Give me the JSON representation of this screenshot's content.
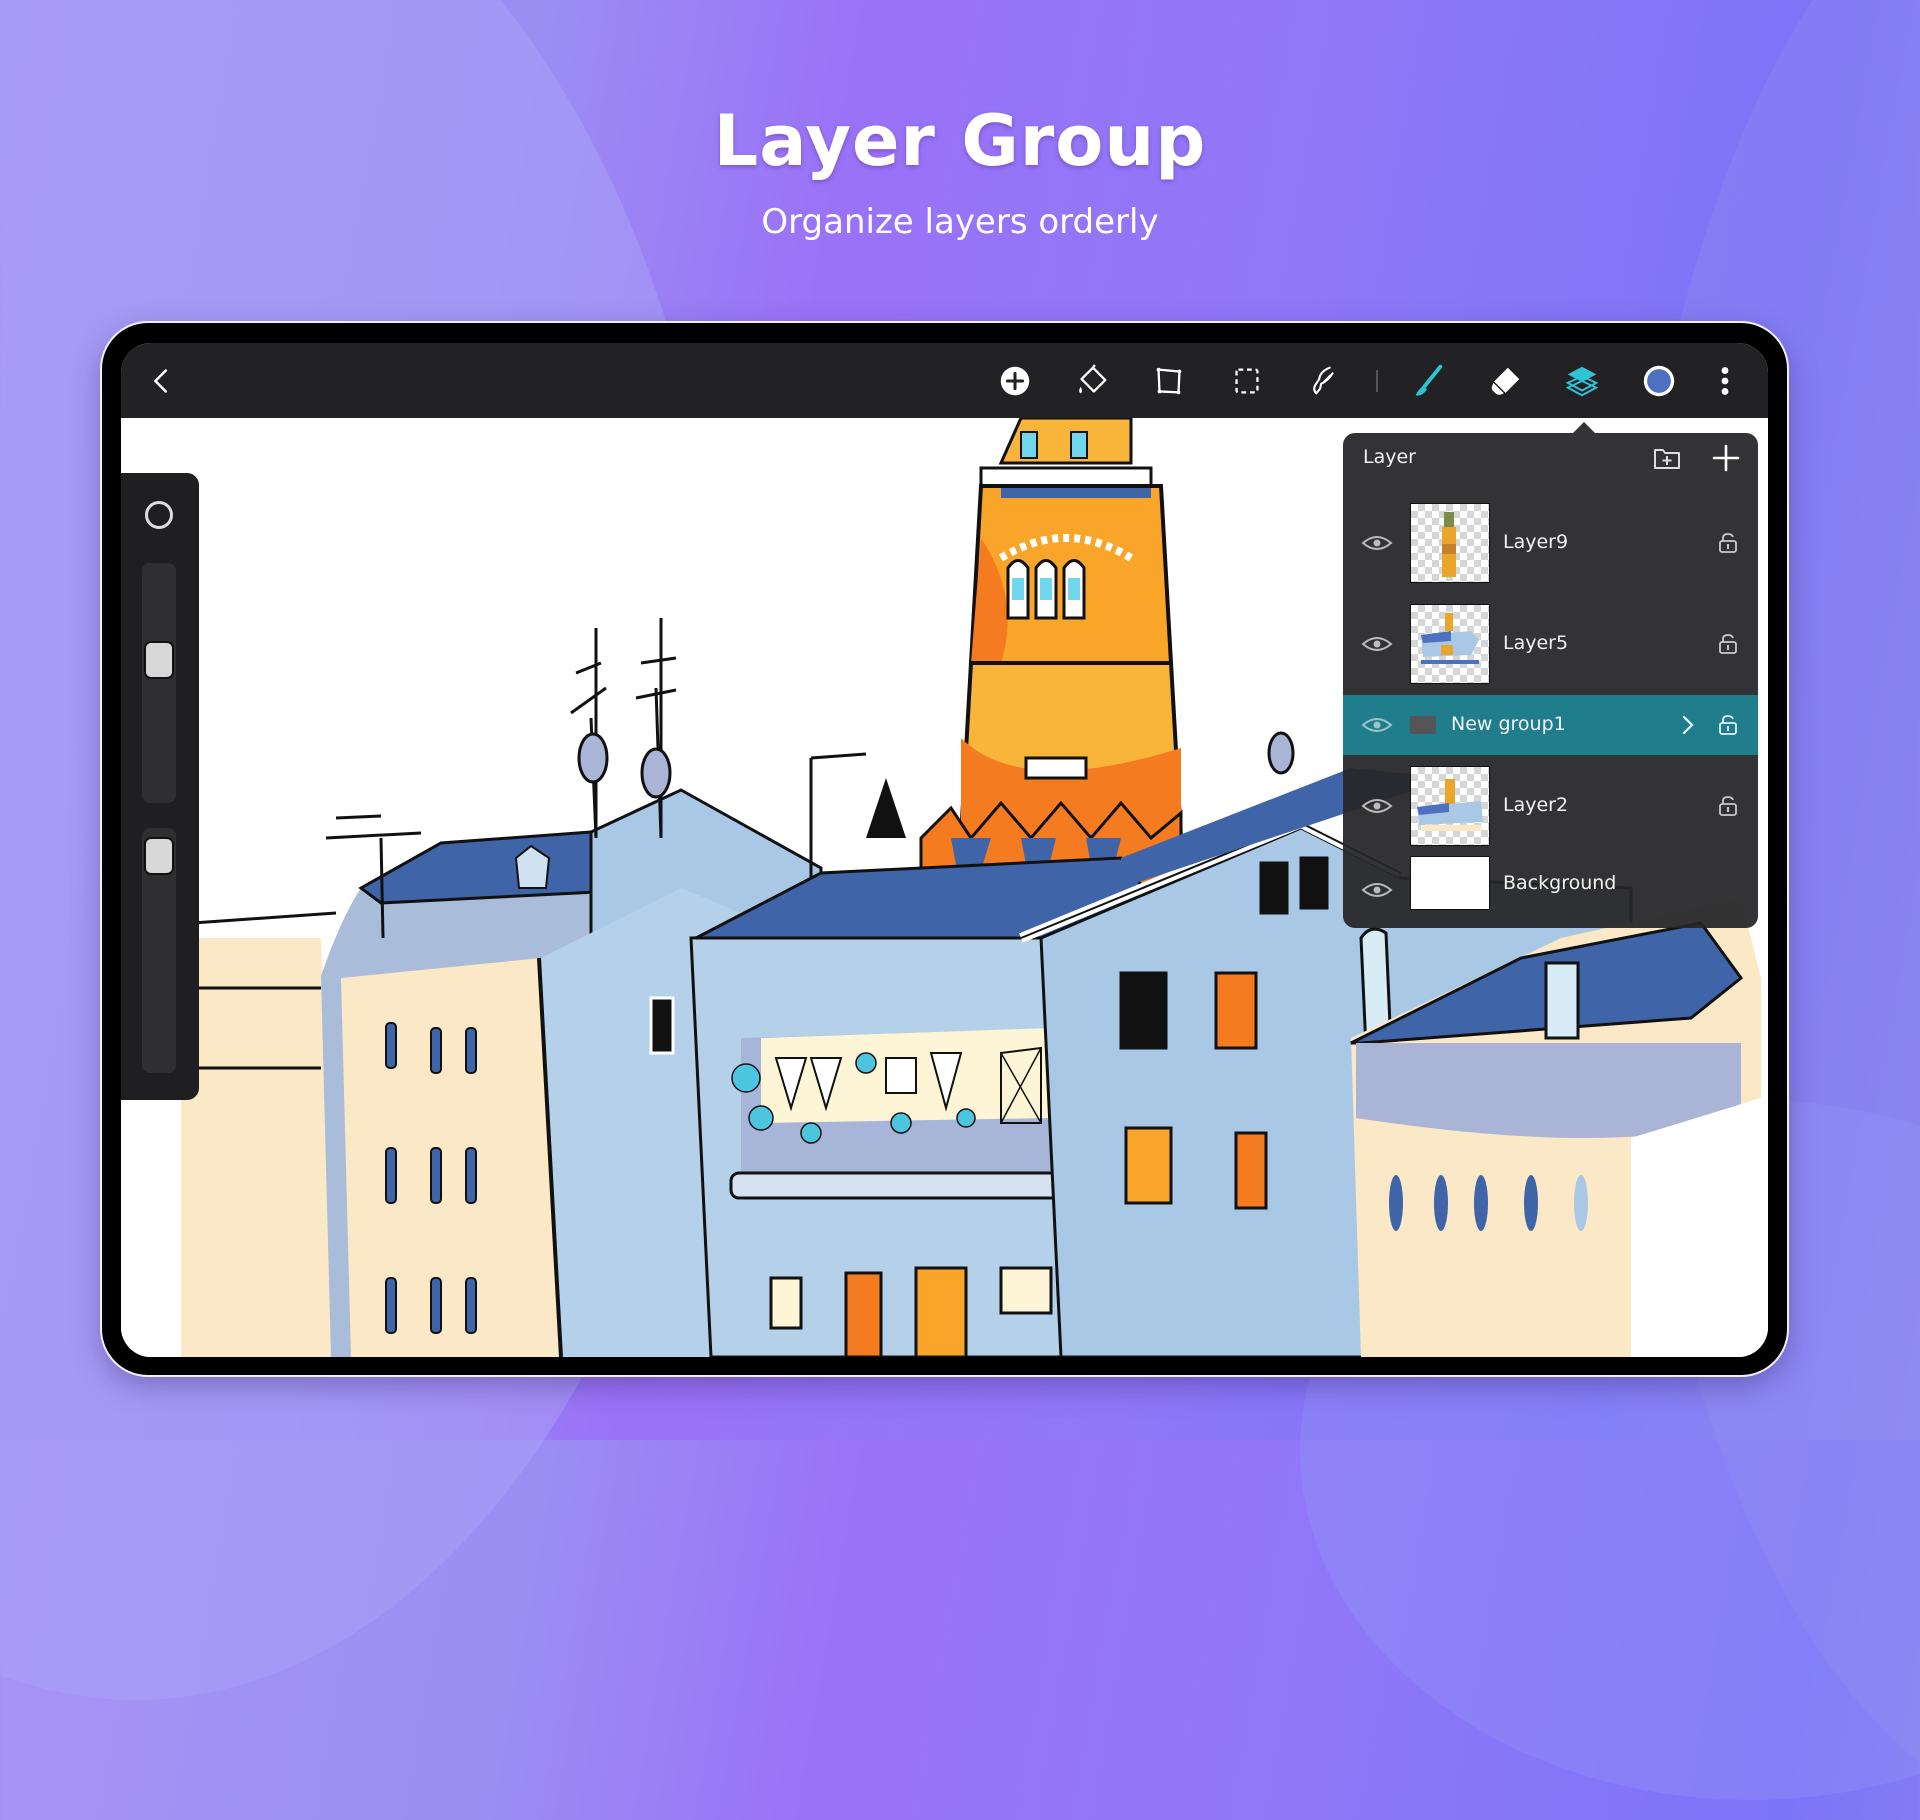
{
  "hero": {
    "title": "Layer Group",
    "subtitle": "Organize layers orderly"
  },
  "toolbar": {
    "back_icon": "chevron-left-icon",
    "tools": [
      {
        "name": "add",
        "icon": "plus-circle-icon"
      },
      {
        "name": "fill",
        "icon": "paint-bucket-icon"
      },
      {
        "name": "transform",
        "icon": "transform-icon"
      },
      {
        "name": "selection",
        "icon": "marquee-select-icon"
      },
      {
        "name": "smudge",
        "icon": "smudge-finger-icon"
      },
      {
        "name": "brush",
        "icon": "brush-icon",
        "active": true
      },
      {
        "name": "eraser",
        "icon": "eraser-icon"
      },
      {
        "name": "layers",
        "icon": "layers-icon",
        "active": true
      },
      {
        "name": "color",
        "icon": "color-swatch-icon"
      },
      {
        "name": "more",
        "icon": "more-vertical-icon"
      }
    ],
    "active_color": "#2ec4d6",
    "current_color": "#4d70c0"
  },
  "side_panel": {
    "brush_size": 0.61,
    "opacity": 0.95
  },
  "layer_panel": {
    "title": "Layer",
    "add_group_icon": "folder-plus-icon",
    "add_layer_icon": "plus-icon",
    "selected_row_color": "#1f7d8c",
    "layers": [
      {
        "name": "Layer9",
        "type": "layer",
        "visible": true,
        "locked": false
      },
      {
        "name": "Layer5",
        "type": "layer",
        "visible": true,
        "locked": false
      },
      {
        "name": "New group1",
        "type": "group",
        "visible": true,
        "locked": false,
        "selected": true
      },
      {
        "name": "Layer2",
        "type": "layer",
        "visible": true,
        "locked": false
      },
      {
        "name": "Background",
        "type": "background",
        "visible": true
      }
    ]
  },
  "colors": {
    "bg_purple": "#9a72f7",
    "toolbar_bg": "#222224",
    "panel_bg": "#262628"
  }
}
